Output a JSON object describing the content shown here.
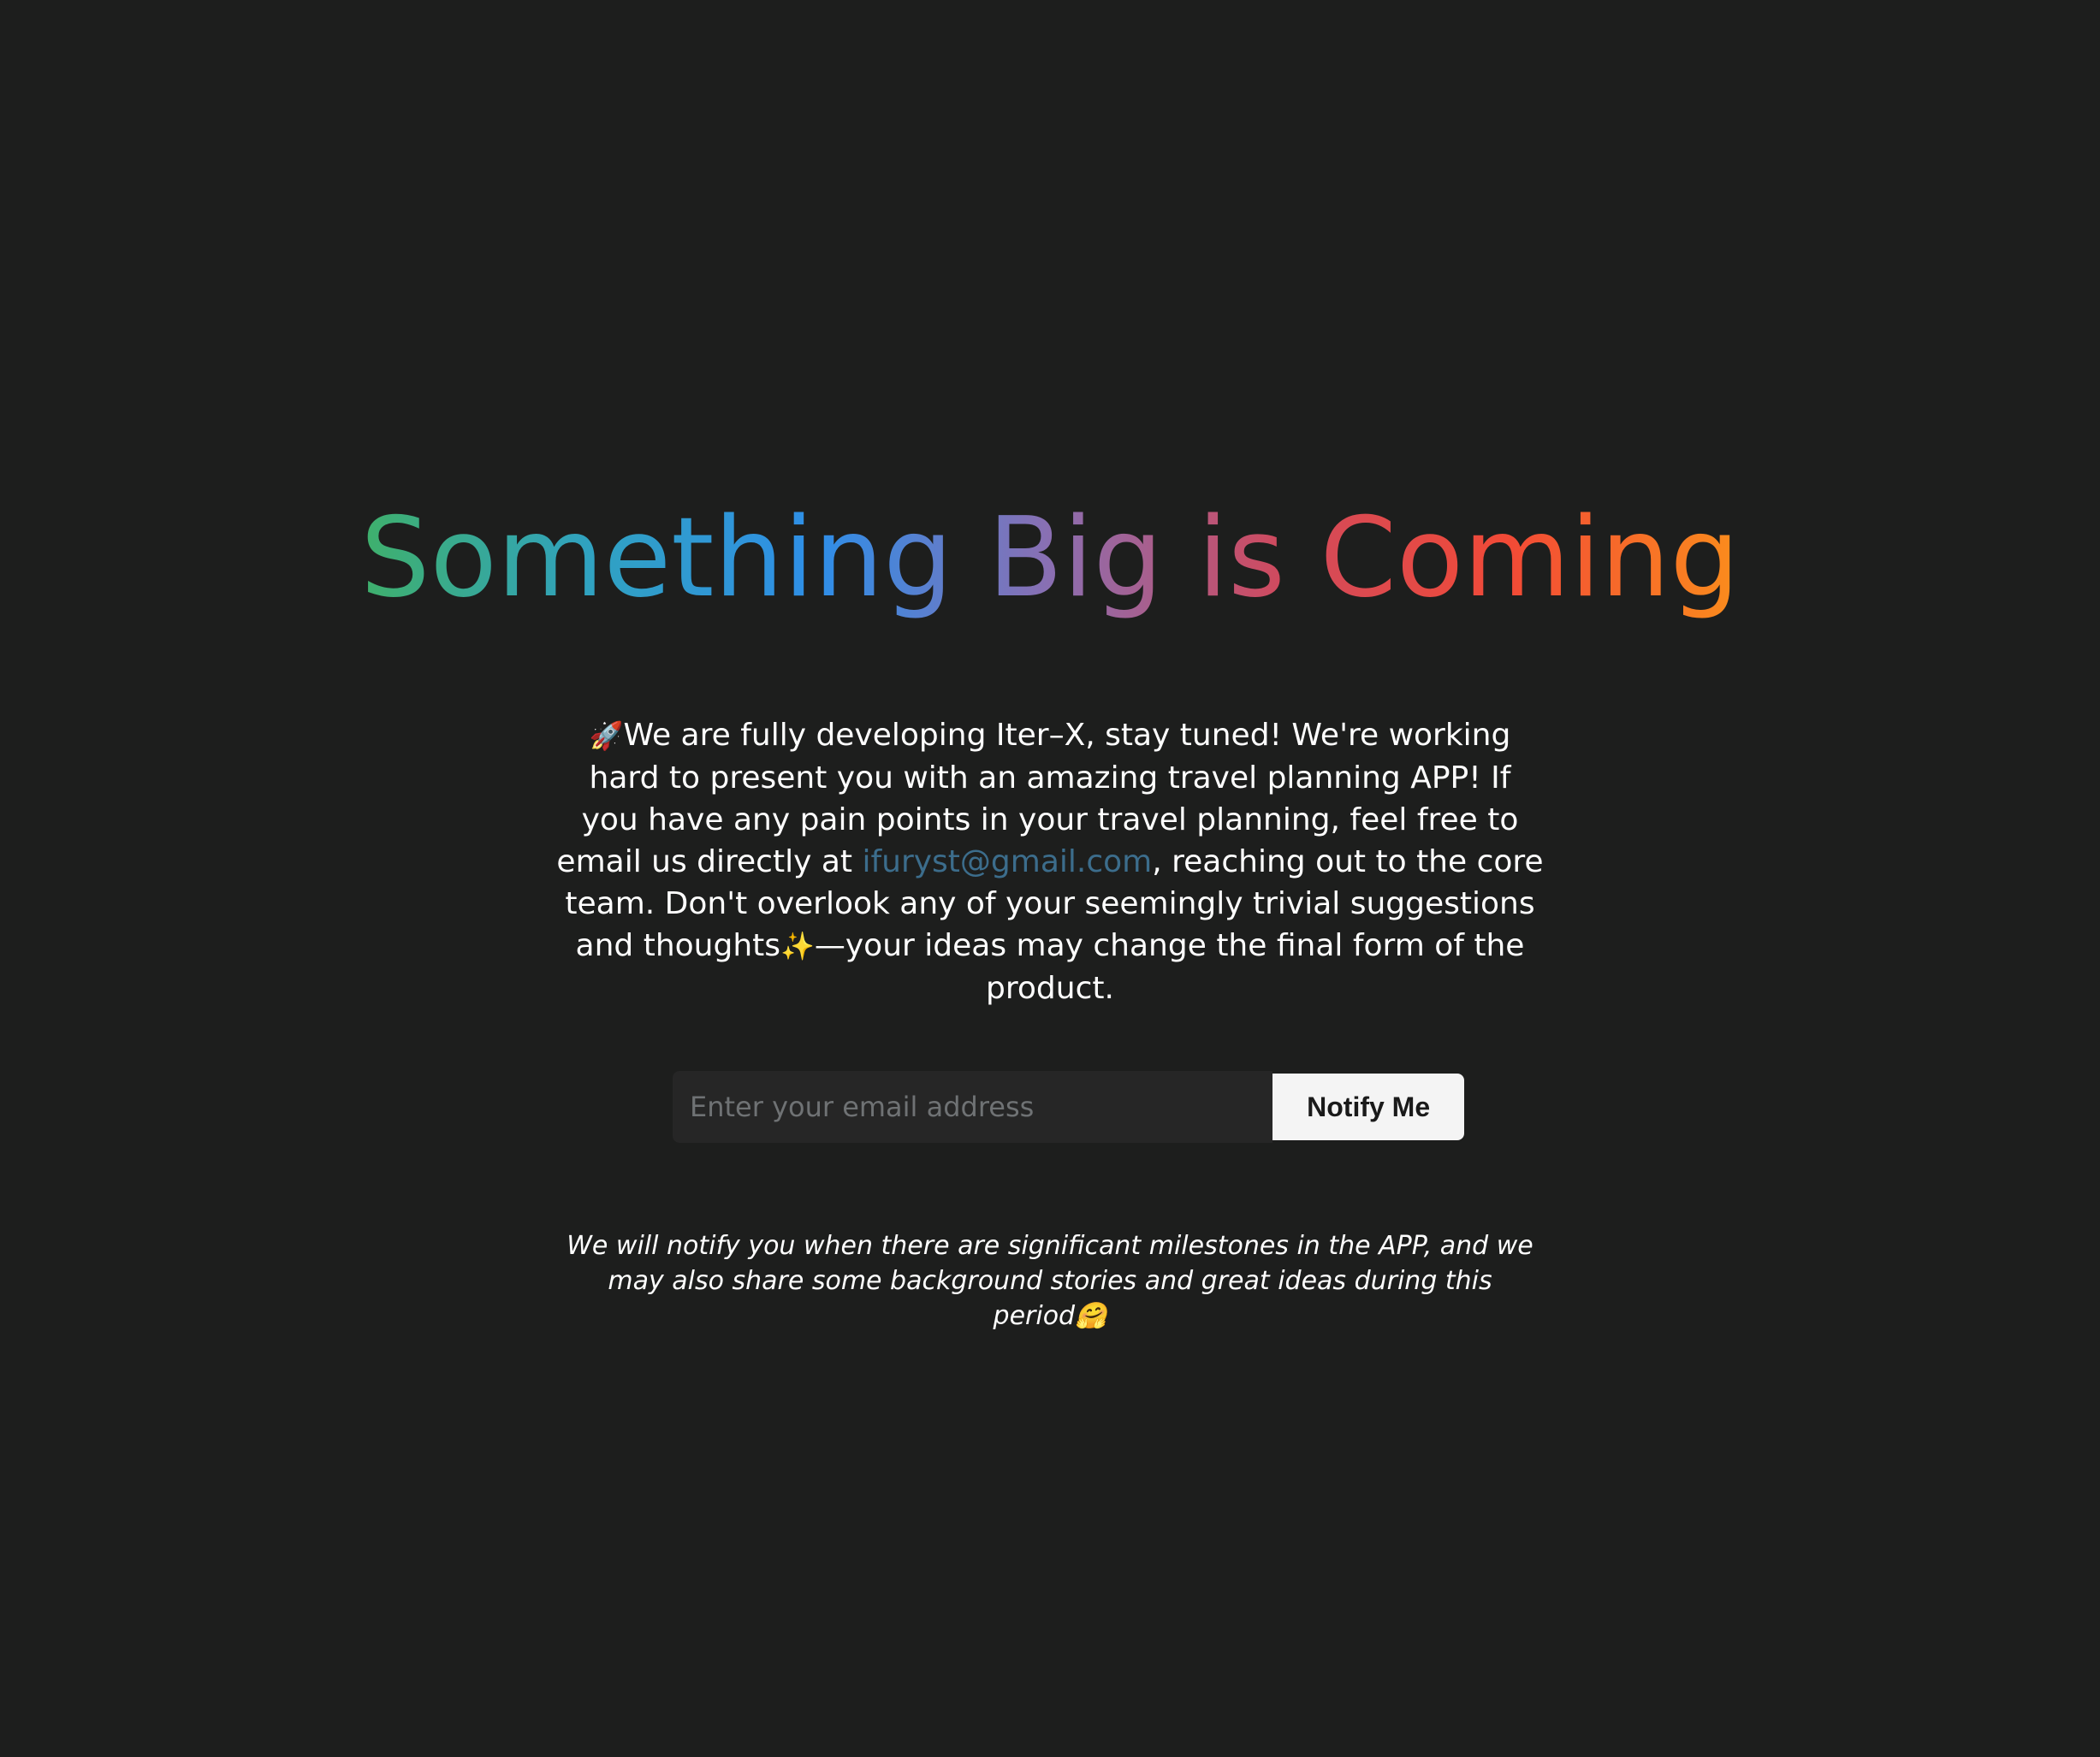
{
  "hero": {
    "headline": "Something Big is Coming",
    "gradient_colors": [
      "#3fb06b",
      "#30a2c1",
      "#2f8ee8",
      "#8a6fb2",
      "#d04a5e",
      "#f24a36",
      "#fb8d1c"
    ]
  },
  "intro": {
    "rocket_emoji": "🚀",
    "text_before_email": "We are fully developing Iter–X, stay tuned! We're working hard to present you with an amazing travel planning APP! If you have any pain points in your travel planning, feel free to email us directly at ",
    "email": "ifuryst@gmail.com",
    "text_after_email": ", reaching out to the core team. Don't overlook any of your seemingly trivial suggestions and thoughts",
    "sparkle_emoji": "✨",
    "text_end": "—your ideas may change the final form of the product.",
    "link_color": "#3c6d8c"
  },
  "signup": {
    "email_placeholder": "Enter your email address",
    "button_label": "Notify Me"
  },
  "footnote": {
    "text": "We will notify you when there are significant milestones in the APP, and we may also share some background stories and great ideas during this period",
    "hug_emoji": "🤗"
  },
  "colors": {
    "background": "#1d1e1d",
    "input_background": "#262626",
    "button_background": "#f4f4f4"
  }
}
